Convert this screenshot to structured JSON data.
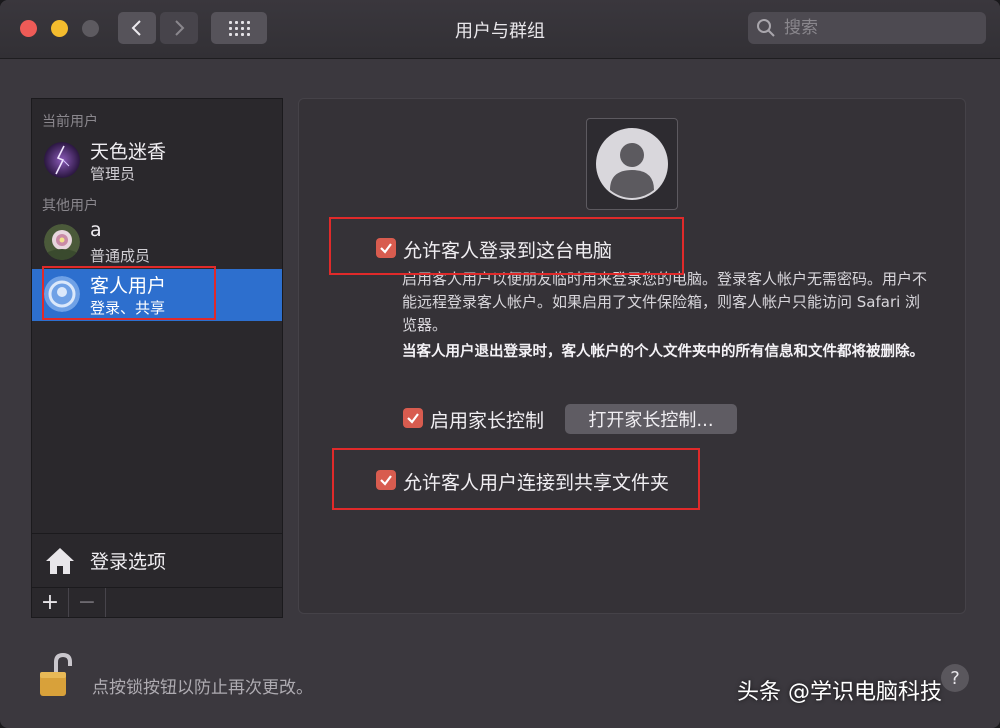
{
  "window": {
    "title": "用户与群组"
  },
  "search": {
    "placeholder": "搜索"
  },
  "sidebar": {
    "current_label": "当前用户",
    "other_label": "其他用户",
    "users": [
      {
        "name": "天色迷香",
        "role": "管理员",
        "avatar": "lightning-avatar"
      },
      {
        "name": "a",
        "role": "普通成员",
        "avatar": "flower-avatar"
      },
      {
        "name": "客人用户",
        "role": "登录、共享",
        "avatar": "guest-avatar",
        "selected": true
      }
    ],
    "login_options": "登录选项",
    "add_label": "+",
    "remove_label": "−"
  },
  "panel": {
    "allow_guest_login": {
      "label": "允许客人登录到这台电脑",
      "checked": true
    },
    "desc1": "启用客人用户以便朋友临时用来登录您的电脑。登录客人帐户无需密码。用户不能远程登录客人帐户。如果启用了文件保险箱，则客人帐户只能访问 Safari 浏览器。",
    "desc2": "当客人用户退出登录时，客人帐户的个人文件夹中的所有信息和文件都将被删除。",
    "parental_controls": {
      "label": "启用家长控制",
      "checked": true
    },
    "open_parental_button": "打开家长控制...",
    "allow_shared_folders": {
      "label": "允许客人用户连接到共享文件夹",
      "checked": true
    }
  },
  "footer": {
    "lock_text": "点按锁按钮以防止再次更改。",
    "help": "?"
  },
  "watermark": "头条 @学识电脑科技",
  "colors": {
    "accent": "#2d6fce",
    "checkbox": "#d85c4f",
    "highlight_box": "#e02a2a"
  }
}
